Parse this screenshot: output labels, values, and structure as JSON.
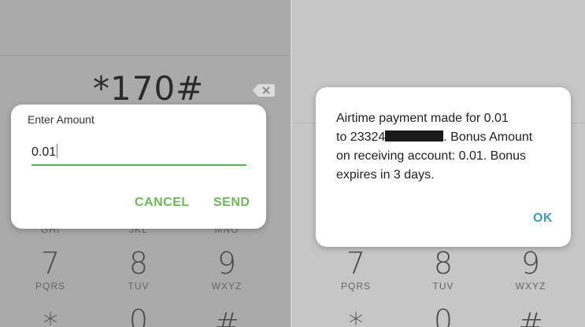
{
  "left_screen": {
    "dialed_number": "*170#",
    "keypad_row_hints": [
      "GHI",
      "JKL",
      "MNO"
    ],
    "keypad": [
      {
        "num": "7",
        "letters": "PQRS"
      },
      {
        "num": "8",
        "letters": "TUV"
      },
      {
        "num": "9",
        "letters": "WXYZ"
      }
    ],
    "bottom_keys": [
      "*",
      "0",
      "#"
    ],
    "amount_dialog": {
      "title": "Enter Amount",
      "value": "0.01",
      "cancel_label": "CANCEL",
      "send_label": "SEND"
    }
  },
  "right_screen": {
    "message_dialog": {
      "line1": "Airtime payment made for 0.01",
      "line2_prefix": "to 23324",
      "line2_suffix": ". Bonus Amount",
      "line3": "on receiving account: 0.01. Bonus",
      "line4": "expires in 3 days.",
      "ok_label": "OK"
    },
    "keypad": [
      {
        "num": "7",
        "letters": "PQRS"
      },
      {
        "num": "8",
        "letters": "TUV"
      },
      {
        "num": "9",
        "letters": "WXYZ"
      }
    ],
    "bottom_keys": [
      "*",
      "0",
      "#"
    ]
  },
  "colors": {
    "accent_green": "#6bb85a",
    "accent_blue": "#3a9ab8",
    "left_background": "#aaaaaa",
    "right_background": "#c6c6c6"
  }
}
